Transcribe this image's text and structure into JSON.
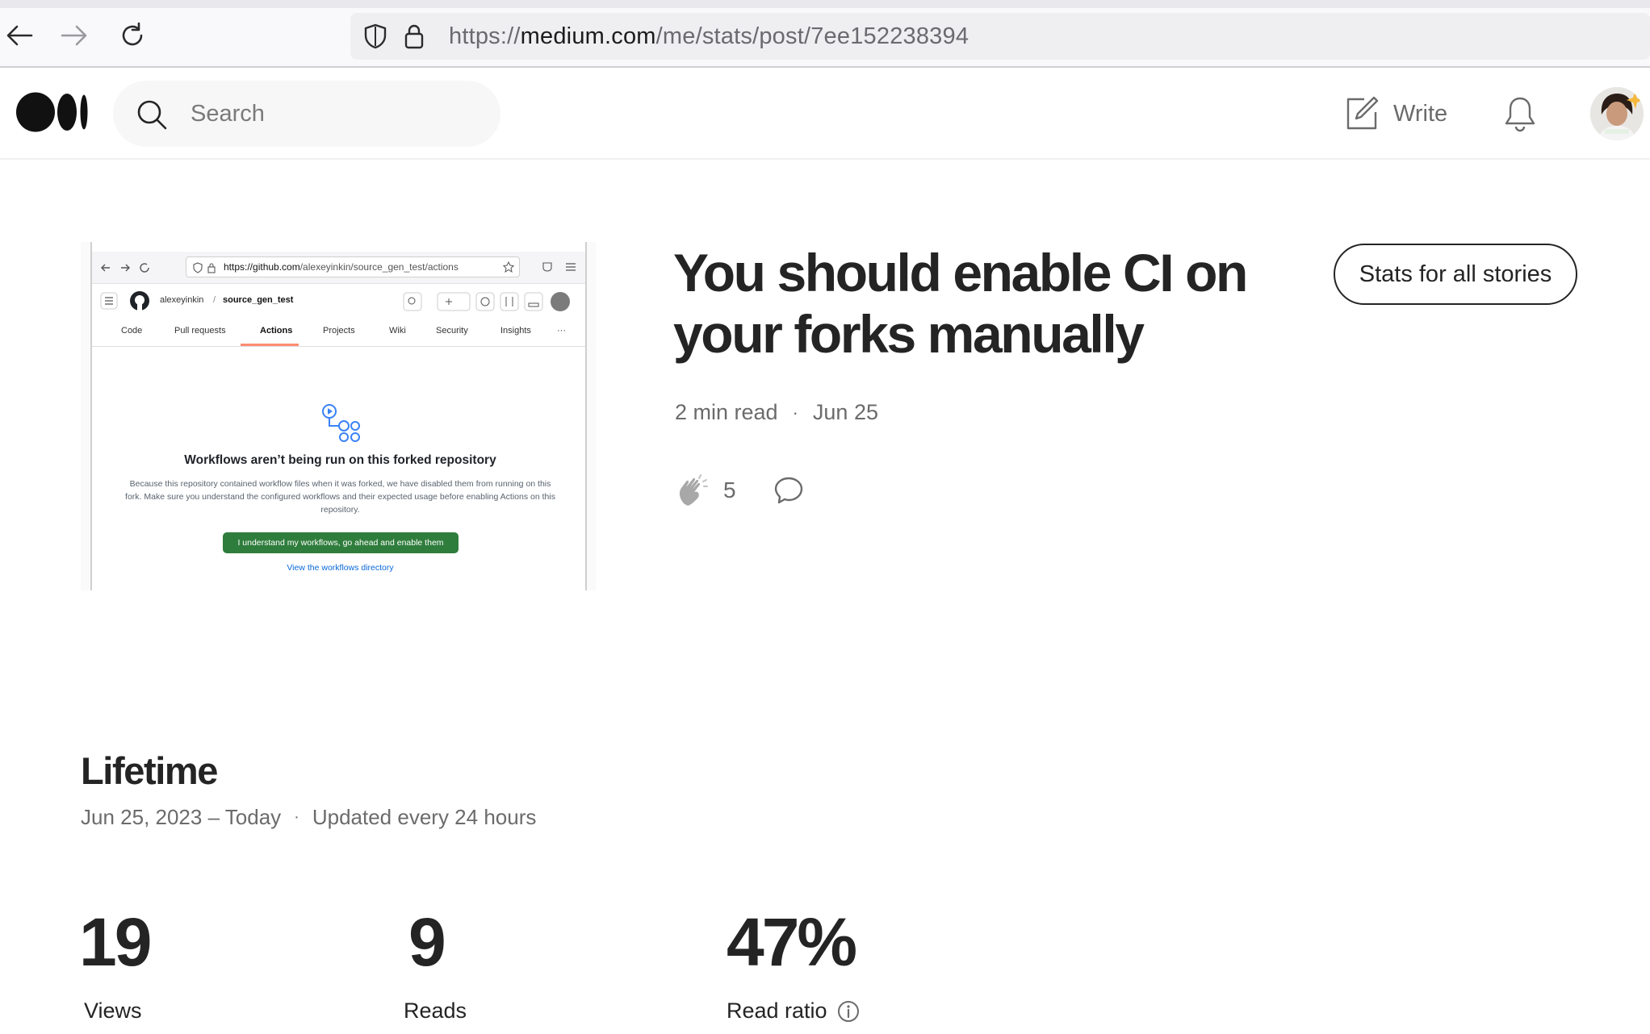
{
  "browser": {
    "url_prefix": "https://",
    "url_host": "medium.com",
    "url_path": "/me/stats/post/7ee152238394"
  },
  "header": {
    "search_placeholder": "Search",
    "write_label": "Write"
  },
  "story": {
    "title": "You should enable CI on your forks manually",
    "stats_all_button": "Stats for all stories",
    "read_time": "2 min read",
    "date": "Jun 25",
    "separator": "·",
    "claps": "5"
  },
  "thumbnail": {
    "url_host": "https://github.com",
    "url_path": "/alexeyinkin/source_gen_test/actions",
    "owner": "alexeyinkin",
    "slash": "/",
    "repo": "source_gen_test",
    "tabs": [
      "Code",
      "Pull requests",
      "Actions",
      "Projects",
      "Wiki",
      "Security",
      "Insights"
    ],
    "more": "···",
    "heading": "Workflows aren’t being run on this forked repository",
    "description": "Because this repository contained workflow files when it was forked, we have disabled them from running on this fork. Make sure you understand the configured workflows and their expected usage before enabling Actions on this repository.",
    "enable_button": "I understand my workflows, go ahead and enable them",
    "workflows_link": "View the workflows directory"
  },
  "lifetime": {
    "title": "Lifetime",
    "range": "Jun 25, 2023 – Today",
    "separator": "·",
    "updated": "Updated every 24 hours",
    "stats": [
      {
        "value": "19",
        "label": "Views"
      },
      {
        "value": "9",
        "label": "Reads"
      },
      {
        "value": "47%",
        "label": "Read ratio"
      }
    ]
  },
  "colors": {
    "text": "#242424",
    "muted": "#6b6b6b",
    "github_green": "#2f7d3c",
    "github_link": "#0969da"
  },
  "icons": [
    "back-arrow-icon",
    "forward-arrow-icon",
    "reload-icon",
    "shield-icon",
    "lock-icon",
    "medium-logo-icon",
    "search-icon",
    "write-icon",
    "bell-icon",
    "clap-icon",
    "comment-icon",
    "info-icon"
  ]
}
